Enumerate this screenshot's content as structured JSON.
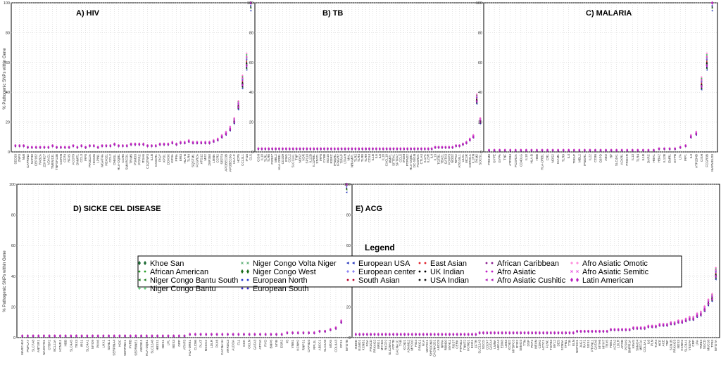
{
  "figure": {
    "ylabel": "% Pathogenic SNPs within Gene",
    "legend_title": "Legend"
  },
  "legend": [
    {
      "name": "Khoe San",
      "marker": "diamond",
      "color": "#1d6b35"
    },
    {
      "name": "African American",
      "marker": "circle",
      "color": "#2ca02c"
    },
    {
      "name": "Niger Congo Bantu South",
      "marker": "triangle-left",
      "color": "#1b7a1b"
    },
    {
      "name": "Niger Congo Bantu",
      "marker": "plus",
      "color": "#3cbf5a"
    },
    {
      "name": "Niger Congo Volta Niger",
      "marker": "x",
      "color": "#4fa86a"
    },
    {
      "name": "Niger Congo West",
      "marker": "diamond",
      "color": "#1a6d1a"
    },
    {
      "name": "European North",
      "marker": "circle",
      "color": "#2233cc"
    },
    {
      "name": "European South",
      "marker": "circle",
      "color": "#3a2ecc"
    },
    {
      "name": "European USA",
      "marker": "triangle-left",
      "color": "#1a2bb8"
    },
    {
      "name": "European center",
      "marker": "plus",
      "color": "#6a5ff0"
    },
    {
      "name": "South Asian",
      "marker": "circle",
      "color": "#b8002b"
    },
    {
      "name": "East Asian",
      "marker": "circle",
      "color": "#e0202a"
    },
    {
      "name": "UK Indian",
      "marker": "circle",
      "color": "#000000"
    },
    {
      "name": "USA Indian",
      "marker": "circle",
      "color": "#111111"
    },
    {
      "name": "African Caribbean",
      "marker": "circle",
      "color": "#8a1f8f"
    },
    {
      "name": "Afro Asiatic",
      "marker": "circle",
      "color": "#c21fc8"
    },
    {
      "name": "Afro Asiatic Cushitic",
      "marker": "triangle-left",
      "color": "#b01ab8"
    },
    {
      "name": "Afro Asiatic Omotic",
      "marker": "plus",
      "color": "#ff6ad0"
    },
    {
      "name": "Afro Asiatic Semitic",
      "marker": "x",
      "color": "#e855e0"
    },
    {
      "name": "Latin American",
      "marker": "diamond",
      "color": "#b81ebe"
    }
  ],
  "chart_data": [
    {
      "type": "scatter",
      "title": "A)  HIV",
      "ylabel": "% Pathogenic SNPs within Gene",
      "ylim": [
        0,
        100
      ],
      "yticks": [
        0,
        20,
        40,
        60,
        80,
        100
      ],
      "grid": true,
      "categories": [
        "SEC63",
        "ZNF3",
        "NMI",
        "CAPRIN2",
        "SAP30",
        "CEP162",
        "RAB2A",
        "ZDHHC7",
        "VDAC1",
        "TMEM131",
        "TNFSF13B",
        "CORIN",
        "CD74",
        "RFX5",
        "ACOT9",
        "DNMT1",
        "CCL3",
        "IRF8",
        "PIK3C2A",
        "HCG26",
        "LPIN1",
        "MGAT4A",
        "FBX021",
        "CCL2",
        "DNM1L",
        "HLA-DQB1",
        "CCR5",
        "SMARCD1",
        "TRIM5",
        "PSMD3",
        "PTPRC",
        "ITGA6",
        "C1QTNF3",
        "IL1B",
        "CX3CR1",
        "PIGY",
        "XPO1",
        "DDX3X",
        "KIF3A",
        "PPIA",
        "ERI3",
        "HLA-B",
        "TLR4",
        "SQSTM1",
        "FCGR2A",
        "ATG12",
        "MX2",
        "ZNF350",
        "LMNA",
        "CCR2",
        "SEPT4",
        "APOBEC3B",
        "APOBEC3G",
        "HLA-C",
        "HCP5",
        "CCL3L1",
        "IFI16",
        "C1S"
      ],
      "values": [
        4,
        4,
        4,
        3,
        3,
        3,
        3,
        3,
        3,
        4,
        3,
        3,
        3,
        3,
        4,
        3,
        4,
        3,
        4,
        4,
        3,
        4,
        4,
        4,
        5,
        4,
        4,
        4,
        5,
        5,
        5,
        5,
        4,
        4,
        4,
        5,
        5,
        5,
        6,
        5,
        6,
        6,
        7,
        6,
        6,
        6,
        6,
        6,
        7,
        8,
        10,
        12,
        15,
        20,
        30,
        45,
        58,
        100
      ],
      "annotations": [
        "A)  HIV"
      ]
    },
    {
      "type": "scatter",
      "title": "B)  TB",
      "ylim": [
        0,
        100
      ],
      "yticks": [
        0,
        20,
        40,
        60,
        80,
        100
      ],
      "grid": true,
      "categories": [
        "CISH",
        "IL10",
        "TLR1",
        "TLR6",
        "P2RX7",
        "MBL2",
        "HLA-DRB1",
        "CD209",
        "IFNG",
        "CCL2",
        "SLC11A1",
        "TNF",
        "NOS2",
        "VDR",
        "SP110",
        "IL12B",
        "IL12RB1",
        "STAT1",
        "IRF8",
        "CYBB",
        "ISG15",
        "RORC",
        "IFNGR1",
        "IFNGR2",
        "TIRAP",
        "LTA4H",
        "MAL",
        "NRAMP1",
        "TLR2",
        "TLR4",
        "TLR8",
        "TLR9",
        "CD14",
        "IL1B",
        "IL6",
        "IL8",
        "IL18",
        "CXCL10",
        "MMP1",
        "SFTPA1",
        "SFTPA2",
        "CCL5",
        "IRGM",
        "PTPN22",
        "HLA-DQB1",
        "DC-SIGN",
        "FCGR2A",
        "CTLA4",
        "IL17A",
        "IL23R",
        "IL4",
        "IL13",
        "TGFB1",
        "TBX21",
        "GATA3",
        "FOXP3",
        "NOD2",
        "RIPK2",
        "ATG16L1",
        "ULK1",
        "MC3R",
        "CORO1A",
        "IL1RN",
        "PKM2",
        "SOCS1"
      ],
      "values": [
        2,
        2,
        2,
        2,
        2,
        2,
        2,
        2,
        2,
        2,
        2,
        2,
        2,
        2,
        2,
        2,
        2,
        2,
        2,
        2,
        2,
        2,
        2,
        2,
        2,
        2,
        2,
        2,
        2,
        2,
        2,
        2,
        2,
        2,
        2,
        2,
        2,
        2,
        2,
        2,
        2,
        2,
        2,
        2,
        2,
        2,
        2,
        2,
        2,
        2,
        2,
        3,
        3,
        3,
        3,
        3,
        3,
        4,
        4,
        5,
        6,
        8,
        10,
        34,
        20
      ],
      "annotations": [
        "B)  TB"
      ]
    },
    {
      "type": "scatter",
      "title": "C)  MALARIA",
      "ylim": [
        0,
        100
      ],
      "yticks": [
        0,
        20,
        40,
        60,
        80,
        100
      ],
      "grid": true,
      "categories": [
        "FREM3",
        "GYPE",
        "GYPA",
        "TNF",
        "ATP2B4",
        "FCGR2A",
        "CD40LG",
        "IL10",
        "HLA-B",
        "HBB",
        "HLA-DRB1",
        "CR1",
        "NOS2",
        "ICAM1",
        "TLR9",
        "IL4",
        "TIRAP",
        "MBL2",
        "IFNGR1",
        "IL22",
        "CD36",
        "G6PD",
        "ABO",
        "HP",
        "SLC4A1",
        "ACKR1",
        "PROCR",
        "IL13",
        "TLR4",
        "IL1B",
        "DARC",
        "HBA1",
        "HBA2",
        "IL12B",
        "EMR1",
        "GYPB",
        "LTA",
        "IRF1",
        "IL3",
        "ATP2B4B",
        "CISH",
        "FCGR3B",
        "MARVELD3"
      ],
      "values": [
        1,
        1,
        1,
        1,
        1,
        1,
        1,
        1,
        1,
        1,
        1,
        1,
        1,
        1,
        1,
        1,
        1,
        1,
        1,
        1,
        1,
        1,
        1,
        1,
        1,
        1,
        1,
        1,
        1,
        1,
        1,
        1,
        2,
        2,
        2,
        2,
        3,
        4,
        10,
        12,
        44,
        58,
        100
      ],
      "annotations": [
        "C)  MALARIA"
      ]
    },
    {
      "type": "scatter",
      "title": "D)  SICKE CEL DISEASE",
      "ylabel": "% Pathogenic SNPs within Gene",
      "ylim": [
        0,
        100
      ],
      "yticks": [
        0,
        20,
        40,
        60,
        80,
        100
      ],
      "grid": true,
      "categories": [
        "MARCH10",
        "PNPLA7",
        "SLC7A8",
        "ANTXR1",
        "NADSYN1",
        "CTBP2",
        "BCL11A",
        "KCNJ11",
        "HBB",
        "SLC4A5",
        "TBX3",
        "IRS1",
        "SLC4A1",
        "MYO9",
        "PKK6",
        "LHX1",
        "SDNL1",
        "SERPINA4",
        "HDC",
        "SERPINC1",
        "PVRB",
        "SEPRINE1",
        "ABCB11",
        "HLA-DQB1",
        "SLC12A6",
        "HBSS1",
        "NOS1",
        "LPL",
        "NOS3",
        "OPP",
        "ATHF3",
        "HLA-DRB1",
        "CLCN6",
        "PLAT",
        "MCCC2",
        "LDLR",
        "PAX6",
        "CACNA1H",
        "ARRDC3",
        "ALDOA",
        "F11",
        "GCK",
        "OCLN",
        "GATA3",
        "ATP10",
        "RYO",
        "BMP6",
        "MYB",
        "ESR2",
        "F5",
        "VNN1",
        "KCNH2",
        "RNPS1",
        "CAPN10",
        "RPL3L",
        "ABCC1",
        "SLC2A8",
        "MTA5",
        "COL6A3",
        "CPS1",
        "MYO7B"
      ],
      "values": [
        1,
        1,
        1,
        1,
        1,
        1,
        1,
        1,
        1,
        1,
        1,
        1,
        1,
        1,
        1,
        1,
        1,
        1,
        1,
        1,
        1,
        1,
        1,
        1,
        1,
        1,
        1,
        1,
        1,
        1,
        1,
        2,
        2,
        2,
        2,
        2,
        2,
        2,
        2,
        2,
        2,
        2,
        2,
        2,
        2,
        2,
        2,
        2,
        2,
        3,
        3,
        3,
        3,
        3,
        3,
        4,
        4,
        5,
        6,
        10,
        100
      ],
      "annotations": [
        "D)  SICKE CEL DISEASE"
      ]
    },
    {
      "type": "scatter",
      "title": "E)  ACG",
      "ylim": [
        0,
        100
      ],
      "yticks": [
        0,
        20,
        40,
        60,
        80,
        100
      ],
      "grid": true,
      "categories": [
        "IKBKE",
        "ELMO1",
        "KCNB1",
        "FGA",
        "PIK3CD",
        "PRKAG2",
        "NRG1",
        "MYH15",
        "RXFP2",
        "SLC26A11",
        "ATP7B",
        "CACNA1C",
        "TYR",
        "KCNJ1",
        "ADAM12",
        "MYO10",
        "FIG4",
        "PRKG1",
        "GLA",
        "MAP2K1",
        "SHROOM3",
        "CACNA2D1",
        "ABCC8",
        "NPPA",
        "RBM20",
        "MYH11",
        "RGS7",
        "CERK",
        "PTPN22",
        "TNNT2",
        "KCNQ1",
        "EXO1",
        "CFTR",
        "SLC12A3",
        "SGCG",
        "CD247",
        "GATA4",
        "LMNA",
        "ABCA4",
        "EDN3",
        "LDB3",
        "KCNJ2",
        "MYBPC3",
        "RYR2",
        "SMAD3",
        "TTN",
        "DSP",
        "PKP2",
        "NEXN",
        "CDH2",
        "ACTC1",
        "FLNC",
        "TGFB3",
        "MYL2",
        "DES",
        "SCN5A",
        "TPM1",
        "TTR",
        "ELN",
        "NOTCH1",
        "JAG1",
        "RAF1",
        "SOS1",
        "PTPN11",
        "GATA6",
        "MYH6",
        "MYH7",
        "TBX5",
        "FBN1",
        "ACTA2",
        "LDLR",
        "APOB",
        "PCSK9",
        "BMPR1A",
        "KRAS",
        "SMAD4",
        "MEF2A",
        "COL3A1",
        "IL6",
        "PLN",
        "TLR4",
        "HFE",
        "ACE",
        "TNF",
        "SCN1B",
        "PRKAG3",
        "NOS3",
        "KCNH2",
        "SLC8A1",
        "VEGFA",
        "CRP",
        "LPA",
        "TNNI3",
        "SGCD",
        "MUC16",
        "TP53",
        "MYO7A"
      ],
      "values": [
        2,
        2,
        2,
        2,
        2,
        2,
        2,
        2,
        2,
        2,
        2,
        2,
        2,
        2,
        2,
        2,
        2,
        2,
        2,
        2,
        2,
        2,
        2,
        2,
        2,
        2,
        2,
        2,
        2,
        2,
        2,
        2,
        2,
        3,
        3,
        3,
        3,
        3,
        3,
        3,
        3,
        3,
        3,
        3,
        3,
        3,
        3,
        3,
        3,
        3,
        3,
        3,
        3,
        3,
        3,
        3,
        3,
        3,
        3,
        4,
        4,
        4,
        4,
        4,
        4,
        4,
        4,
        4,
        5,
        5,
        5,
        5,
        5,
        5,
        6,
        6,
        6,
        6,
        7,
        7,
        7,
        8,
        8,
        8,
        9,
        9,
        10,
        10,
        11,
        12,
        12,
        14,
        15,
        18,
        22,
        25,
        40
      ],
      "annotations": [
        "E)  ACG"
      ]
    }
  ]
}
